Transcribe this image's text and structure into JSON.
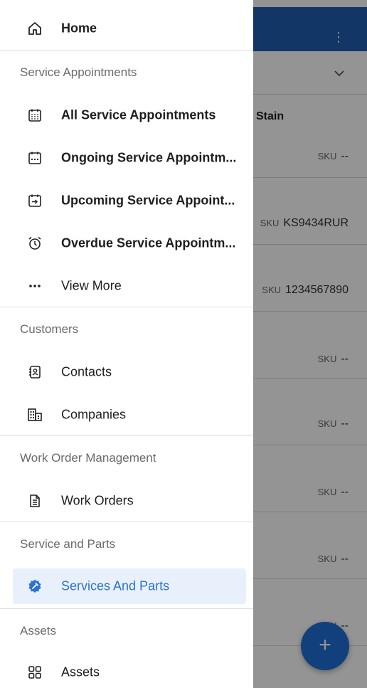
{
  "background": {
    "service_title": "Stain",
    "sku_label": "SKU",
    "rows": [
      {
        "sku": "--"
      },
      {
        "sku": "KS9434RUR"
      },
      {
        "sku": "1234567890"
      },
      {
        "sku": "--"
      },
      {
        "sku": "--"
      },
      {
        "sku": "--"
      },
      {
        "sku": "--"
      },
      {
        "sku": "--"
      }
    ],
    "fab_label": "+"
  },
  "drawer": {
    "home": {
      "label": "Home",
      "icon": "home-icon"
    },
    "sections": [
      {
        "header": "Service Appointments",
        "items": [
          {
            "label": "All Service Appointments",
            "icon": "calendar-icon"
          },
          {
            "label": "Ongoing Service Appointm...",
            "icon": "calendar-dots-icon"
          },
          {
            "label": "Upcoming Service Appoint...",
            "icon": "calendar-arrow-icon"
          },
          {
            "label": "Overdue Service Appointm...",
            "icon": "alarm-clock-icon"
          },
          {
            "label": "View More",
            "icon": "more-dots-icon"
          }
        ]
      },
      {
        "header": "Customers",
        "items": [
          {
            "label": "Contacts",
            "icon": "contacts-icon"
          },
          {
            "label": "Companies",
            "icon": "companies-icon"
          }
        ]
      },
      {
        "header": "Work Order Management",
        "items": [
          {
            "label": "Work Orders",
            "icon": "work-order-icon"
          }
        ]
      },
      {
        "header": "Service and Parts",
        "items": [
          {
            "label": "Services And Parts",
            "icon": "services-parts-icon",
            "selected": true
          }
        ]
      },
      {
        "header": "Assets",
        "items": [
          {
            "label": "Assets",
            "icon": "assets-icon"
          }
        ]
      }
    ]
  },
  "colors": {
    "accent": "#2a73d4",
    "topbar": "#1f5fb0",
    "selected_bg": "#e8f0fb"
  }
}
